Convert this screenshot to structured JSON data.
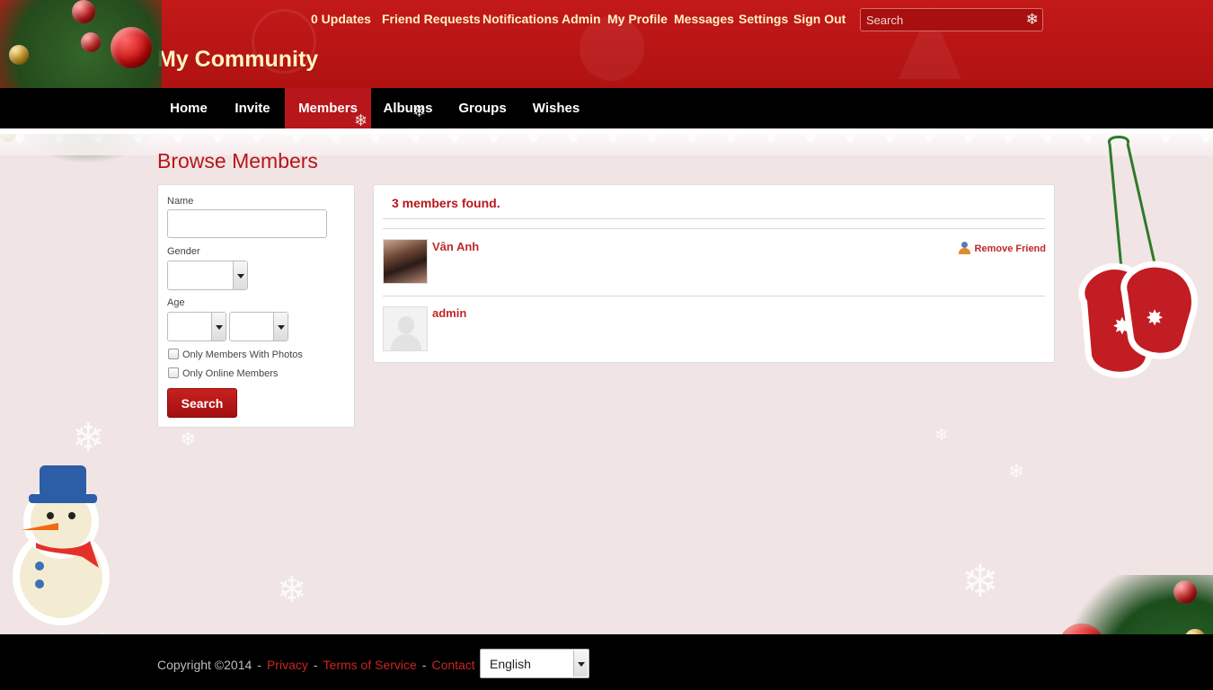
{
  "header": {
    "site_title": "My Community",
    "top_nav": [
      {
        "label": "0 Updates"
      },
      {
        "label": "Friend Requests"
      },
      {
        "label": "Notifications"
      },
      {
        "label": "Admin"
      },
      {
        "label": "My Profile"
      },
      {
        "label": "Messages"
      },
      {
        "label": "Settings"
      },
      {
        "label": "Sign Out"
      }
    ],
    "search_placeholder": "Search"
  },
  "main_nav": {
    "items": [
      {
        "label": "Home"
      },
      {
        "label": "Invite"
      },
      {
        "label": "Members",
        "active": true
      },
      {
        "label": "Albums"
      },
      {
        "label": "Groups"
      },
      {
        "label": "Wishes"
      }
    ]
  },
  "page": {
    "title": "Browse Members"
  },
  "filters": {
    "name_label": "Name",
    "name_value": "",
    "gender_label": "Gender",
    "gender_value": "",
    "age_label": "Age",
    "age_from_value": "",
    "age_to_value": "",
    "only_photos_label": "Only Members With Photos",
    "only_photos_checked": false,
    "only_online_label": "Only Online Members",
    "only_online_checked": false,
    "search_button": "Search"
  },
  "results": {
    "count_text": "3 members found.",
    "members": [
      {
        "name": "Vân Anh",
        "action": "Remove Friend",
        "avatar": "photo"
      },
      {
        "name": "admin",
        "avatar": "blank"
      }
    ]
  },
  "footer": {
    "copyright": "Copyright ©2014",
    "links": [
      {
        "label": "Privacy"
      },
      {
        "label": "Terms of Service"
      },
      {
        "label": "Contact"
      }
    ],
    "language": "English"
  },
  "colors": {
    "header_red": "#c31919",
    "accent_red": "#b7161a",
    "link_red": "#c0282b",
    "nav_black": "#000000",
    "page_bg": "#f1e4e4"
  }
}
